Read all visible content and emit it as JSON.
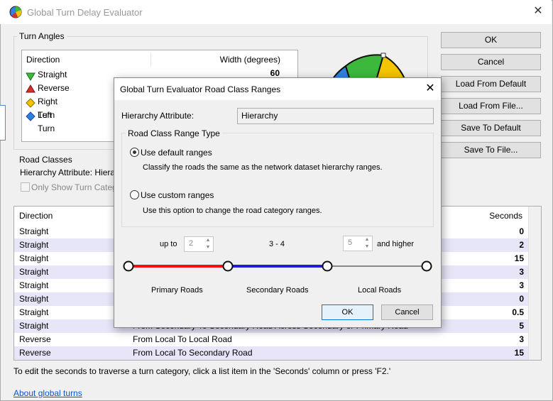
{
  "window": {
    "title": "Global Turn Delay Evaluator",
    "close_glyph": "✕"
  },
  "turn_angles": {
    "group_label": "Turn Angles",
    "col_direction": "Direction",
    "col_width": "Width (degrees)",
    "rows": [
      {
        "label": "Straight",
        "value": "60",
        "icon_color": "#3cb83c",
        "icon": "triangle-down-icon"
      },
      {
        "label": "Reverse",
        "value": "",
        "icon_color": "#d43030",
        "icon": "triangle-up-icon"
      },
      {
        "label": "Right Turn",
        "value": "",
        "icon_color": "#f2c500",
        "icon": "diamond-icon"
      },
      {
        "label": "Left Turn",
        "value": "",
        "icon_color": "#2f80e0",
        "icon": "diamond-icon"
      }
    ]
  },
  "road_classes": {
    "group_label": "Road Classes",
    "hierarchy_label": "Hierarchy Attribute: Hierarc",
    "checkbox_label": "Only Show Turn Categori"
  },
  "delays": {
    "col_direction": "Direction",
    "col_seconds": "Seconds",
    "rows": [
      {
        "direction": "Straight",
        "desc": "",
        "seconds": "0"
      },
      {
        "direction": "Straight",
        "desc": "",
        "seconds": "2"
      },
      {
        "direction": "Straight",
        "desc": "",
        "seconds": "15"
      },
      {
        "direction": "Straight",
        "desc": "",
        "seconds": "3"
      },
      {
        "direction": "Straight",
        "desc": "",
        "seconds": "3"
      },
      {
        "direction": "Straight",
        "desc": "",
        "seconds": "0"
      },
      {
        "direction": "Straight",
        "desc": "",
        "seconds": "0.5"
      },
      {
        "direction": "Straight",
        "desc": "From Secondary To Secondary Road Across Secondary or Primary Road",
        "seconds": "5"
      },
      {
        "direction": "Reverse",
        "desc": "From Local To Local Road",
        "seconds": "3"
      },
      {
        "direction": "Reverse",
        "desc": "From Local To Secondary Road",
        "seconds": "15"
      }
    ]
  },
  "hint_text": "To edit the seconds to traverse a turn category, click a list item in the 'Seconds' column or press 'F2.'",
  "about_link": "About global turns",
  "buttons": {
    "ok": "OK",
    "cancel": "Cancel",
    "load_default": "Load From Default",
    "load_file": "Load From File...",
    "save_default": "Save To Default",
    "save_file": "Save To File..."
  },
  "pie": {
    "colors": {
      "straight": "#3cb83c",
      "right": "#f2c500",
      "left": "#2f80e0"
    }
  },
  "modal": {
    "title": "Global Turn Evaluator Road Class Ranges",
    "close_glyph": "✕",
    "hierarchy_label": "Hierarchy Attribute:",
    "hierarchy_value": "Hierarchy",
    "range_type_label": "Road Class Range Type",
    "option_default": "Use default ranges",
    "option_default_desc": "Classify the roads the same as the network dataset hierarchy ranges.",
    "option_custom": "Use custom ranges",
    "option_custom_desc": "Use this option to change the road category ranges.",
    "up_to": "up to",
    "up_to_value": "2",
    "middle_range": "3 - 4",
    "higher_value": "5",
    "and_higher": "and higher",
    "primary": "Primary Roads",
    "secondary": "Secondary Roads",
    "local": "Local Roads",
    "ok": "OK",
    "cancel": "Cancel",
    "line_colors": {
      "primary": "#ee1111",
      "secondary": "#1f1fd8",
      "local": "#888888"
    },
    "default_selected": true
  }
}
